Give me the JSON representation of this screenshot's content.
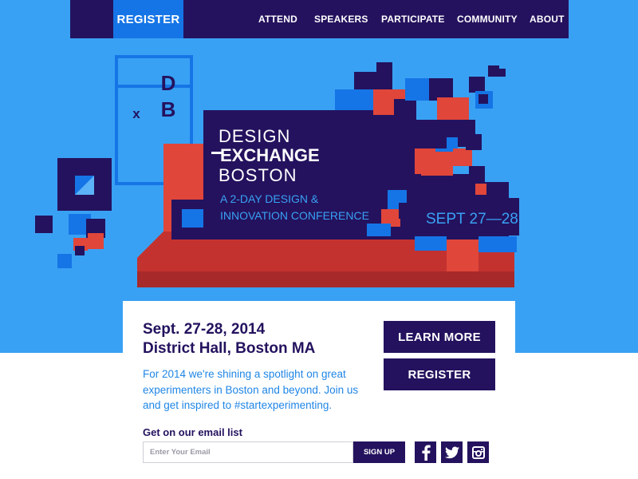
{
  "nav": {
    "register_label": "REGISTER",
    "items": [
      {
        "label": "ATTEND"
      },
      {
        "label": "SPEAKERS"
      },
      {
        "label": "PARTICIPATE"
      },
      {
        "label": "COMMUNITY"
      },
      {
        "label": "ABOUT"
      }
    ]
  },
  "hero": {
    "logo_letters": {
      "top": "D",
      "x": "x",
      "bottom": "B"
    },
    "title_line1": "DESIGN",
    "title_line2": "EXCHANGE",
    "title_line3": "BOSTON",
    "tagline_line1": "A 2-DAY DESIGN &",
    "tagline_line2": "INNOVATION CONFERENCE",
    "dates": "SEPT 27—28"
  },
  "card": {
    "date": "Sept. 27-28, 2014",
    "venue": "District Hall, Boston MA",
    "blurb": "For 2014 we're shining a spotlight on great experimenters in Boston and beyond. Join us and get inspired to #startexperimenting.",
    "learn_more_label": "LEARN MORE",
    "register_label": "REGISTER",
    "email_title": "Get on our email list",
    "email_placeholder": "Enter Your Email",
    "signup_label": "SIGN UP"
  },
  "social": {
    "icons": [
      "facebook-icon",
      "twitter-icon",
      "instagram-icon"
    ]
  },
  "colors": {
    "sky": "#39a1f4",
    "navy": "#24125e",
    "royal": "#1575e6",
    "red": "#e0463a",
    "dark_red": "#b82d2d",
    "accent_text": "#1f86e6"
  }
}
